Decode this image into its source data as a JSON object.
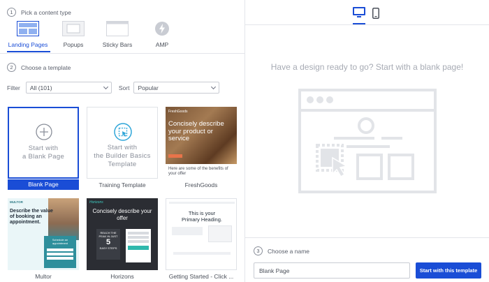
{
  "steps": {
    "step1": {
      "num": "1",
      "label": "Pick a content type"
    },
    "step2": {
      "num": "2",
      "label": "Choose a template"
    },
    "step3": {
      "num": "3",
      "label": "Choose a name"
    }
  },
  "content_types": [
    {
      "label": "Landing Pages",
      "active": true
    },
    {
      "label": "Popups",
      "active": false
    },
    {
      "label": "Sticky Bars",
      "active": false
    },
    {
      "label": "AMP",
      "active": false
    }
  ],
  "filter": {
    "label": "Filter",
    "value": "All (101)"
  },
  "sort": {
    "label": "Sort",
    "value": "Popular"
  },
  "templates": [
    {
      "caption": "Blank Page",
      "thumb_line1": "Start with",
      "thumb_line2": "a Blank Page"
    },
    {
      "caption": "Training Template",
      "thumb_line1": "Start with",
      "thumb_line2": "the Builder Basics",
      "thumb_line3": "Template"
    },
    {
      "caption": "FreshGoods",
      "brand": "FreshGoods",
      "headline": "Concisely describe your product or service",
      "sub": "Here are some of the benefits of your offer"
    },
    {
      "caption": "Multor",
      "brand": "MULTOR",
      "headline": "Describe the value of booking an appointment.",
      "form_title": "Schedule an appointment"
    },
    {
      "caption": "Horizons",
      "brand": "Horizons",
      "headline": "Concisely describe your offer",
      "badge1": "REACH THE PEAK IN JUST",
      "badge_num": "5",
      "badge2": "EASY STEPS"
    },
    {
      "caption": "Getting Started - Click ...",
      "headline_line1": "This is your",
      "headline_line2": "Primary Heading."
    }
  ],
  "right": {
    "headline": "Have a design ready to go? Start with a blank page!",
    "name_value": "Blank Page",
    "start_button": "Start with this template"
  },
  "colors": {
    "accent": "#1a4dd6",
    "illustration": "#e2e4e8"
  }
}
